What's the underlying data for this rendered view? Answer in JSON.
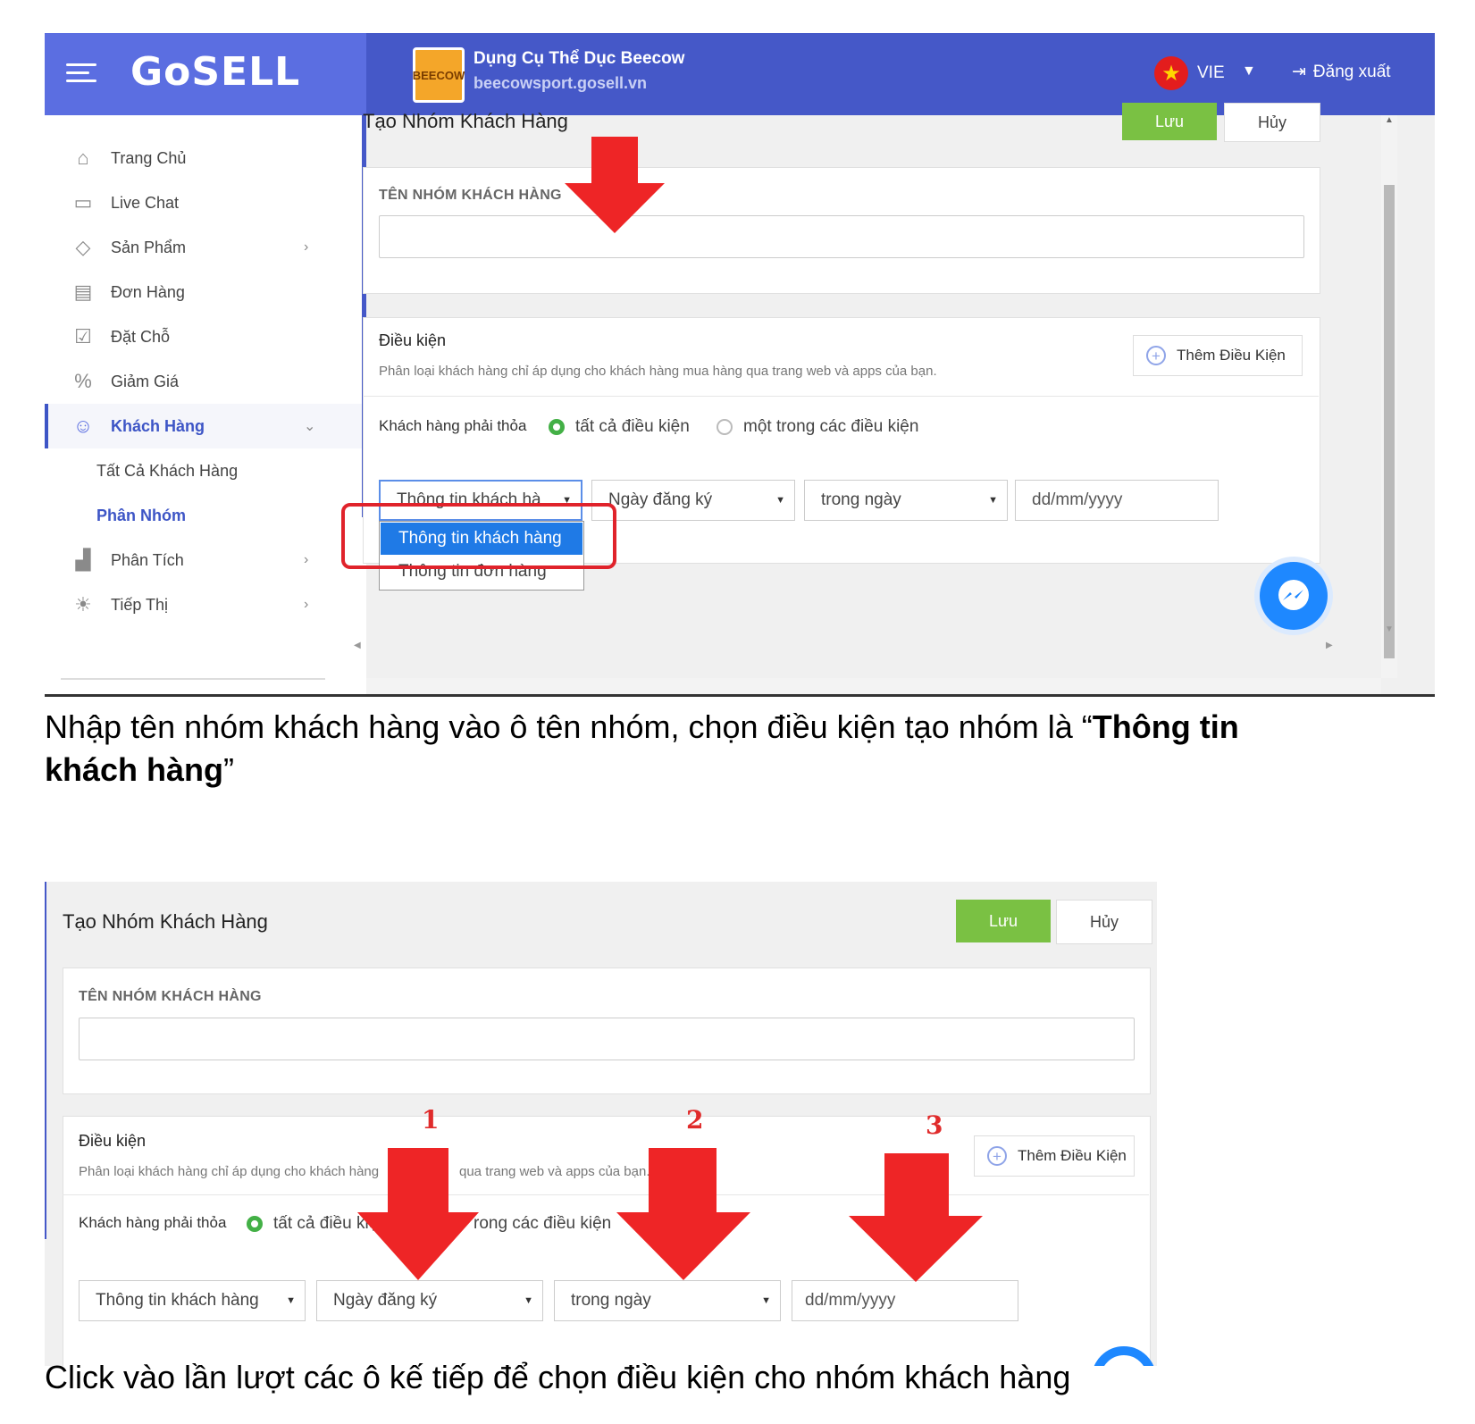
{
  "header": {
    "logo": "GoSELL",
    "store_name": "Dụng Cụ Thể Dục Beecow",
    "store_url": "beecowsport.gosell.vn",
    "store_logo_text": "BEECOW",
    "language": "VIE",
    "logout_label": "Đăng xuất"
  },
  "sidebar": {
    "items": [
      {
        "label": "Trang Chủ"
      },
      {
        "label": "Live Chat"
      },
      {
        "label": "Sản Phẩm"
      },
      {
        "label": "Đơn Hàng"
      },
      {
        "label": "Đặt Chỗ"
      },
      {
        "label": "Giảm Giá"
      },
      {
        "label": "Khách Hàng"
      },
      {
        "label": "Tất Cả Khách Hàng"
      },
      {
        "label": "Phân Nhóm"
      },
      {
        "label": "Phân Tích"
      },
      {
        "label": "Tiếp Thị"
      }
    ]
  },
  "form": {
    "title": "Tạo Nhóm Khách Hàng",
    "save_label": "Lưu",
    "cancel_label": "Hủy",
    "group_name_label": "TÊN NHÓM KHÁCH HÀNG",
    "conditions_title": "Điều kiện",
    "conditions_desc": "Phân loại khách hàng chỉ áp dụng cho khách hàng mua hàng qua trang web và apps của bạn.",
    "add_condition_label": "Thêm Điều Kiện",
    "match_label": "Khách hàng phải thỏa",
    "match_all": "tất cả điều kiện",
    "match_any": "một trong các điều kiện",
    "cond_field_truncated": "Thông tin khách hà",
    "cond_field": "Thông tin khách hàng",
    "cond_field_options": [
      "Thông tin khách hàng",
      "Thông tin đơn hàng"
    ],
    "cond_attribute": "Ngày đăng ký",
    "cond_operator": "trong ngày",
    "date_placeholder": "dd/mm/yyyy"
  },
  "screen2_desc_left": "Phân loại khách hàng chỉ áp dụng cho khách hàng",
  "screen2_desc_right": "qua trang web và apps của bạn.",
  "screen2_match_all": "tất cả điều kiệ",
  "screen2_match_any": "rong các điều kiện",
  "screen2_add_condition": "Thêm Điều Kiện",
  "annotations": {
    "numbers": [
      "1",
      "2",
      "3"
    ]
  },
  "captions": {
    "caption1_part1": "Nhập tên nhóm khách hàng vào ô tên nhóm, chọn điều kiện tạo nhóm là “",
    "caption1_bold_line1": "Thông tin",
    "caption1_bold_line2": "khách hàng",
    "caption1_end": "”",
    "caption2": "Click vào lần lượt các ô kế tiếp để chọn điều kiện cho nhóm khách hàng"
  },
  "colors": {
    "brand_blue": "#5b6ee1",
    "header_blue": "#4558c8",
    "save_green": "#7ac143",
    "radio_green": "#43b046",
    "annotation_red": "#ee2526",
    "dropdown_selected": "#1f7ae6",
    "messenger_blue": "#1e88ff"
  }
}
